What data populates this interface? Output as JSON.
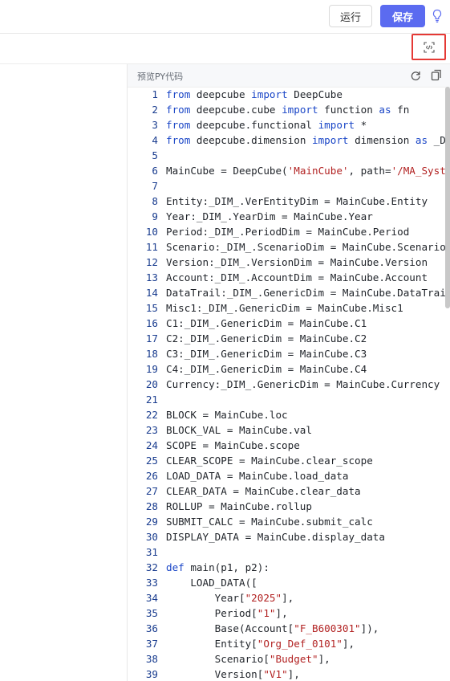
{
  "toolbar": {
    "run_label": "运行",
    "save_label": "保存",
    "accent_color": "#5b6bf0"
  },
  "preview": {
    "title": "预览PY代码"
  },
  "icons": [
    "lightbulb-icon",
    "code-toggle-icon",
    "refresh-icon",
    "copy-icon"
  ],
  "code_lines": [
    {
      "n": "1",
      "segs": [
        [
          "kw",
          "from"
        ],
        [
          "t",
          " deepcube "
        ],
        [
          "kw",
          "import"
        ],
        [
          "t",
          " DeepCube"
        ]
      ]
    },
    {
      "n": "2",
      "segs": [
        [
          "kw",
          "from"
        ],
        [
          "t",
          " deepcube.cube "
        ],
        [
          "kw",
          "import"
        ],
        [
          "t",
          " function "
        ],
        [
          "kw",
          "as"
        ],
        [
          "t",
          " fn"
        ]
      ]
    },
    {
      "n": "3",
      "segs": [
        [
          "kw",
          "from"
        ],
        [
          "t",
          " deepcube.functional "
        ],
        [
          "kw",
          "import"
        ],
        [
          "t",
          " *"
        ]
      ]
    },
    {
      "n": "4",
      "segs": [
        [
          "kw",
          "from"
        ],
        [
          "t",
          " deepcube.dimension "
        ],
        [
          "kw",
          "import"
        ],
        [
          "t",
          " dimension "
        ],
        [
          "kw",
          "as"
        ],
        [
          "t",
          " _D"
        ]
      ]
    },
    {
      "n": "5",
      "segs": []
    },
    {
      "n": "6",
      "segs": [
        [
          "t",
          "MainCube = DeepCube("
        ],
        [
          "str",
          "'MainCube'"
        ],
        [
          "t",
          ", path="
        ],
        [
          "str",
          "'/MA_Syst"
        ]
      ]
    },
    {
      "n": "7",
      "segs": []
    },
    {
      "n": "8",
      "segs": [
        [
          "t",
          "Entity:_DIM_.VerEntityDim = MainCube.Entity"
        ]
      ]
    },
    {
      "n": "9",
      "segs": [
        [
          "t",
          "Year:_DIM_.YearDim = MainCube.Year"
        ]
      ]
    },
    {
      "n": "10",
      "segs": [
        [
          "t",
          "Period:_DIM_.PeriodDim = MainCube.Period"
        ]
      ]
    },
    {
      "n": "11",
      "segs": [
        [
          "t",
          "Scenario:_DIM_.ScenarioDim = MainCube.Scenario"
        ]
      ]
    },
    {
      "n": "12",
      "segs": [
        [
          "t",
          "Version:_DIM_.VersionDim = MainCube.Version"
        ]
      ]
    },
    {
      "n": "13",
      "segs": [
        [
          "t",
          "Account:_DIM_.AccountDim = MainCube.Account"
        ]
      ]
    },
    {
      "n": "14",
      "segs": [
        [
          "t",
          "DataTrail:_DIM_.GenericDim = MainCube.DataTrai"
        ]
      ]
    },
    {
      "n": "15",
      "segs": [
        [
          "t",
          "Misc1:_DIM_.GenericDim = MainCube.Misc1"
        ]
      ]
    },
    {
      "n": "16",
      "segs": [
        [
          "t",
          "C1:_DIM_.GenericDim = MainCube.C1"
        ]
      ]
    },
    {
      "n": "17",
      "segs": [
        [
          "t",
          "C2:_DIM_.GenericDim = MainCube.C2"
        ]
      ]
    },
    {
      "n": "18",
      "segs": [
        [
          "t",
          "C3:_DIM_.GenericDim = MainCube.C3"
        ]
      ]
    },
    {
      "n": "19",
      "segs": [
        [
          "t",
          "C4:_DIM_.GenericDim = MainCube.C4"
        ]
      ]
    },
    {
      "n": "20",
      "segs": [
        [
          "t",
          "Currency:_DIM_.GenericDim = MainCube.Currency"
        ]
      ]
    },
    {
      "n": "21",
      "segs": []
    },
    {
      "n": "22",
      "segs": [
        [
          "t",
          "BLOCK = MainCube.loc"
        ]
      ]
    },
    {
      "n": "23",
      "segs": [
        [
          "t",
          "BLOCK_VAL = MainCube.val"
        ]
      ]
    },
    {
      "n": "24",
      "segs": [
        [
          "t",
          "SCOPE = MainCube.scope"
        ]
      ]
    },
    {
      "n": "25",
      "segs": [
        [
          "t",
          "CLEAR_SCOPE = MainCube.clear_scope"
        ]
      ]
    },
    {
      "n": "26",
      "segs": [
        [
          "t",
          "LOAD_DATA = MainCube.load_data"
        ]
      ]
    },
    {
      "n": "27",
      "segs": [
        [
          "t",
          "CLEAR_DATA = MainCube.clear_data"
        ]
      ]
    },
    {
      "n": "28",
      "segs": [
        [
          "t",
          "ROLLUP = MainCube.rollup"
        ]
      ]
    },
    {
      "n": "29",
      "segs": [
        [
          "t",
          "SUBMIT_CALC = MainCube.submit_calc"
        ]
      ]
    },
    {
      "n": "30",
      "segs": [
        [
          "t",
          "DISPLAY_DATA = MainCube.display_data"
        ]
      ]
    },
    {
      "n": "31",
      "segs": []
    },
    {
      "n": "32",
      "segs": [
        [
          "kw",
          "def"
        ],
        [
          "t",
          " main(p1, p2):"
        ]
      ]
    },
    {
      "n": "33",
      "segs": [
        [
          "t",
          "    LOAD_DATA(["
        ]
      ]
    },
    {
      "n": "34",
      "segs": [
        [
          "t",
          "        Year["
        ],
        [
          "str",
          "\"2025\""
        ],
        [
          "t",
          "],"
        ]
      ]
    },
    {
      "n": "35",
      "segs": [
        [
          "t",
          "        Period["
        ],
        [
          "str",
          "\"1\""
        ],
        [
          "t",
          "],"
        ]
      ]
    },
    {
      "n": "36",
      "segs": [
        [
          "t",
          "        Base(Account["
        ],
        [
          "str",
          "\"F_B600301\""
        ],
        [
          "t",
          "]),"
        ]
      ]
    },
    {
      "n": "37",
      "segs": [
        [
          "t",
          "        Entity["
        ],
        [
          "str",
          "\"Org_Def_0101\""
        ],
        [
          "t",
          "],"
        ]
      ]
    },
    {
      "n": "38",
      "segs": [
        [
          "t",
          "        Scenario["
        ],
        [
          "str",
          "\"Budget\""
        ],
        [
          "t",
          "],"
        ]
      ]
    },
    {
      "n": "39",
      "segs": [
        [
          "t",
          "        Version["
        ],
        [
          "str",
          "\"V1\""
        ],
        [
          "t",
          "],"
        ]
      ]
    }
  ]
}
